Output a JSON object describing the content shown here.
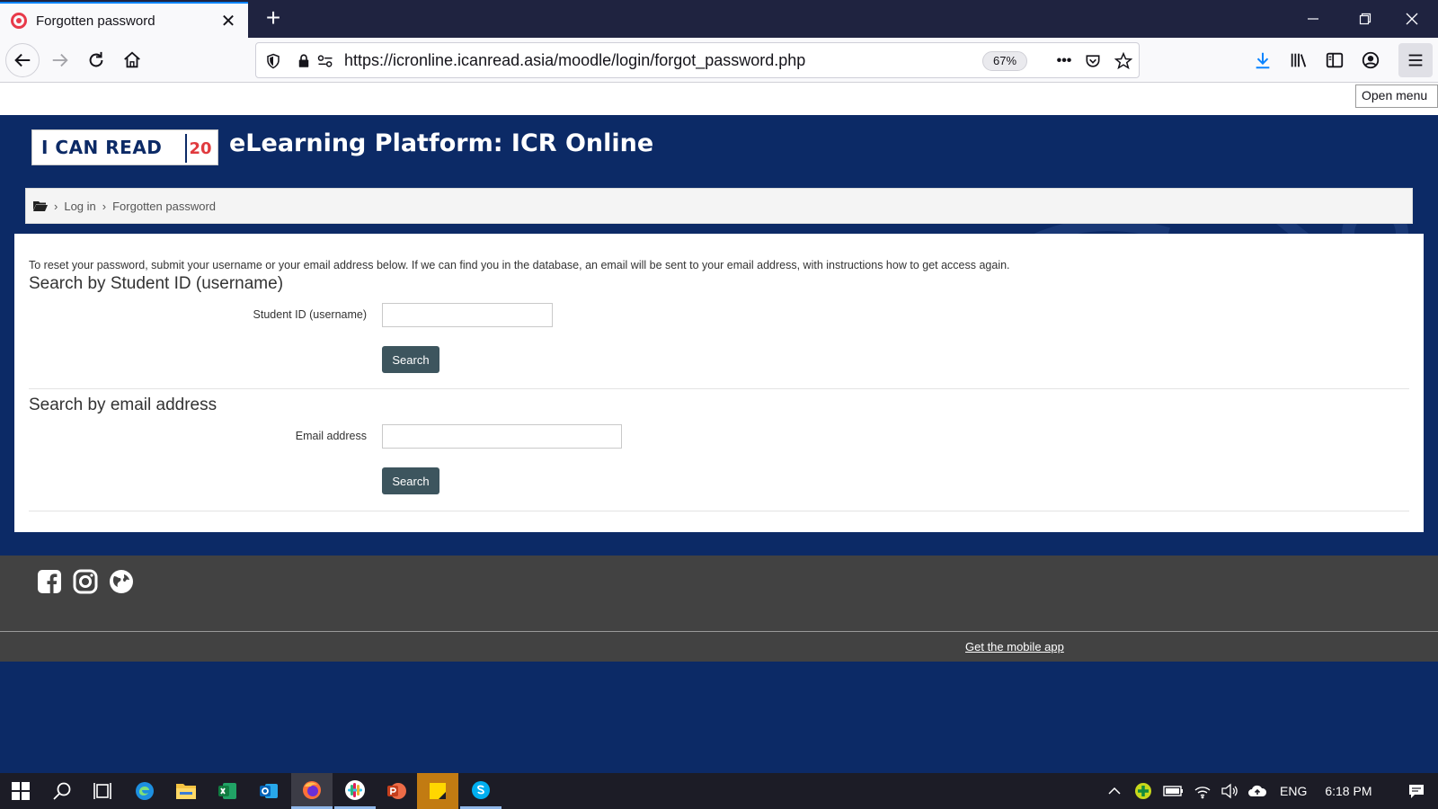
{
  "browser": {
    "tab_title": "Forgotten password",
    "tab_close": "✕",
    "new_tab": "+",
    "url": "https://icronline.icanread.asia/moodle/login/forgot_password.php",
    "zoom": "67%",
    "more": "•••",
    "tooltip": "Open menu"
  },
  "site": {
    "logo_text": "I CAN READ",
    "logo_badge": "20",
    "title": "eLearning Platform: ICR Online"
  },
  "breadcrumb": {
    "sep": "›",
    "items": [
      "Log in",
      "Forgotten password"
    ]
  },
  "form": {
    "intro": "To reset your password, submit your username or your email address below. If we can find you in the database, an email will be sent to your email address, with instructions how to get access again.",
    "username_section": {
      "title": "Search by Student ID (username)",
      "label": "Student ID (username)",
      "value": "",
      "button": "Search"
    },
    "email_section": {
      "title": "Search by email address",
      "label": "Email address",
      "value": "",
      "button": "Search"
    }
  },
  "footer": {
    "mobile_app": "Get the mobile app"
  },
  "taskbar": {
    "language": "ENG",
    "time": "6:18 PM"
  },
  "colors": {
    "brand_navy": "#0c2a66",
    "button": "#3d555e",
    "footer": "#424242",
    "accent_red": "#e83a4a"
  }
}
